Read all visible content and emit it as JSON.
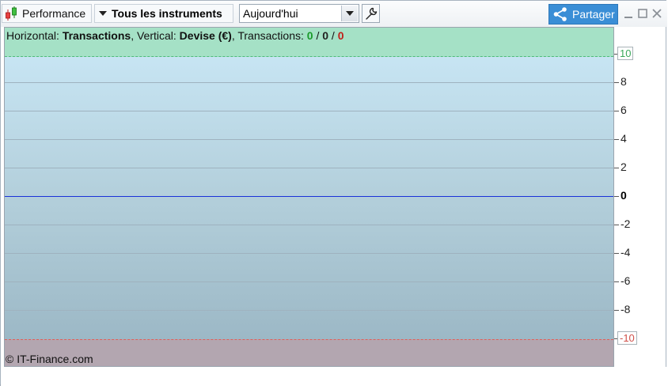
{
  "toolbar": {
    "performance_label": "Performance",
    "instruments_label": "Tous les instruments",
    "period_value": "Aujourd'hui",
    "share_label": "Partager"
  },
  "info": {
    "horizontal_prefix": "Horizontal:",
    "horizontal_value": "Transactions",
    "vertical_prefix": ", Vertical:",
    "vertical_value": "Devise (€)",
    "transactions_prefix": ", Transactions:",
    "tx_positive": "0",
    "tx_neutral": "0",
    "tx_negative": "0",
    "sep": "/"
  },
  "copyright": "© IT-Finance.com",
  "colors": {
    "accent": "#3a8ed6",
    "positive": "#1a9a2a",
    "negative": "#c0201a",
    "zero_line": "#1a32d8"
  },
  "chart_data": {
    "type": "line",
    "xlabel": "Transactions",
    "ylabel": "Devise (€)",
    "ylim": [
      -12,
      12
    ],
    "upper_threshold": 10,
    "lower_threshold": -10,
    "series": [],
    "y_ticks": [
      {
        "value": 10,
        "label": "10"
      },
      {
        "value": 8,
        "label": "8"
      },
      {
        "value": 6,
        "label": "6"
      },
      {
        "value": 4,
        "label": "4"
      },
      {
        "value": 2,
        "label": "2"
      },
      {
        "value": 0,
        "label": "0"
      },
      {
        "value": -2,
        "label": "-2"
      },
      {
        "value": -4,
        "label": "-4"
      },
      {
        "value": -6,
        "label": "-6"
      },
      {
        "value": -8,
        "label": "-8"
      },
      {
        "value": -10,
        "label": "-10"
      }
    ]
  }
}
